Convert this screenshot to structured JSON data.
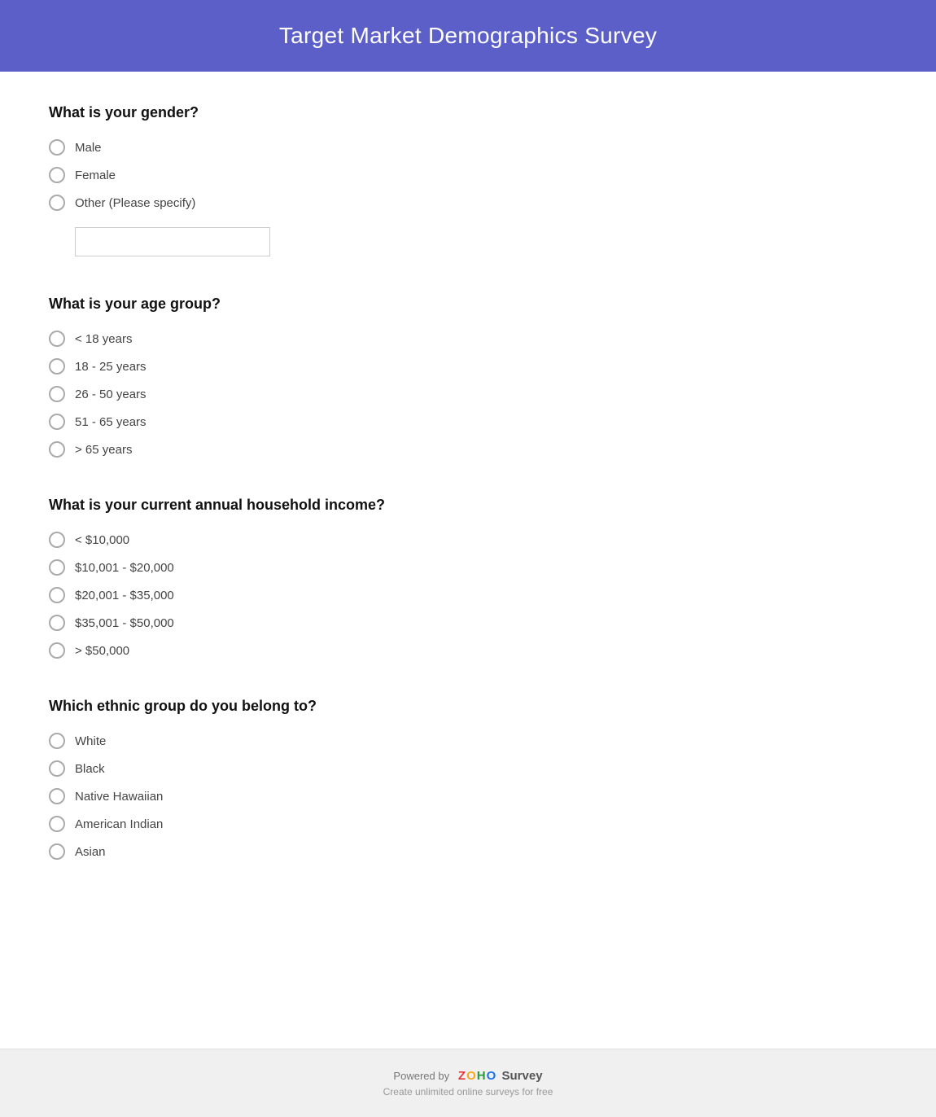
{
  "header": {
    "title": "Target Market Demographics Survey",
    "bg_color": "#5b5fc7"
  },
  "questions": [
    {
      "id": "gender",
      "title": "What is your gender?",
      "type": "radio_with_other",
      "options": [
        "Male",
        "Female",
        "Other (Please specify)"
      ],
      "has_specify": true,
      "specify_index": 2
    },
    {
      "id": "age_group",
      "title": "What is your age group?",
      "type": "radio",
      "options": [
        "< 18 years",
        "18 - 25 years",
        "26 - 50 years",
        "51 - 65 years",
        "> 65 years"
      ]
    },
    {
      "id": "income",
      "title": "What is your current annual household income?",
      "type": "radio",
      "options": [
        "< $10,000",
        "$10,001 - $20,000",
        "$20,001 - $35,000",
        "$35,001 - $50,000",
        "> $50,000"
      ]
    },
    {
      "id": "ethnicity",
      "title": "Which ethnic group do you belong to?",
      "type": "radio",
      "options": [
        "White",
        "Black",
        "Native Hawaiian",
        "American Indian",
        "Asian"
      ]
    }
  ],
  "footer": {
    "powered_by_text": "Powered by",
    "zoho_letters": [
      "Z",
      "O",
      "H",
      "O"
    ],
    "survey_label": "Survey",
    "tagline": "Create unlimited online surveys for free"
  }
}
